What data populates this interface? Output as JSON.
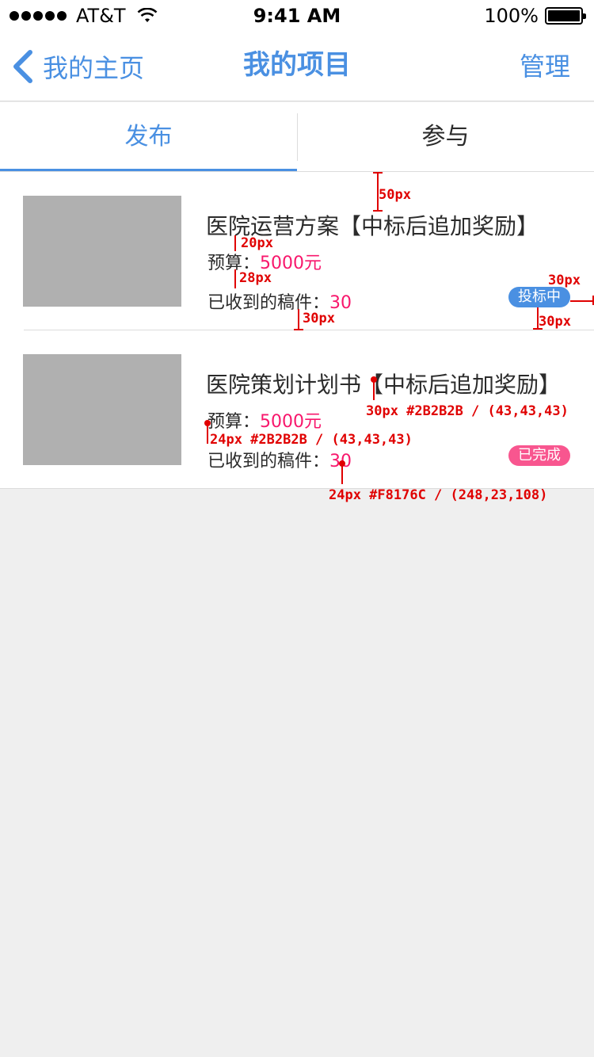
{
  "status_bar": {
    "carrier": "AT&T",
    "time": "9:41 AM",
    "battery": "100%"
  },
  "nav": {
    "back_label": "我的主页",
    "title": "我的项目",
    "right_label": "管理"
  },
  "tabs": [
    {
      "label": "发布",
      "active": true
    },
    {
      "label": "参与",
      "active": false
    }
  ],
  "items": [
    {
      "title": "医院运营方案【中标后追加奖励】",
      "budget_label": "预算：",
      "budget_value": "5000元",
      "count_label": "已收到的稿件：",
      "count_value": "30",
      "status": "投标中"
    },
    {
      "title": "医院策划计划书【中标后追加奖励】",
      "budget_label": "预算：",
      "budget_value": "5000元",
      "count_label": "已收到的稿件：",
      "count_value": "30",
      "status": "已完成"
    }
  ],
  "annotations": {
    "a1": "50px",
    "a2": "20px",
    "a3": "28px",
    "a4": "30px",
    "a5": "30px",
    "a6": "30px",
    "a7": "30px #2B2B2B / (43,43,43)",
    "a8": "24px #2B2B2B / (43,43,43)",
    "a9": "24px #F8176C / (248,23,108)"
  },
  "colors": {
    "accent": "#4a90e2",
    "pink": "#f8176c",
    "text": "#2b2b2b",
    "annotation": "#e00000"
  }
}
